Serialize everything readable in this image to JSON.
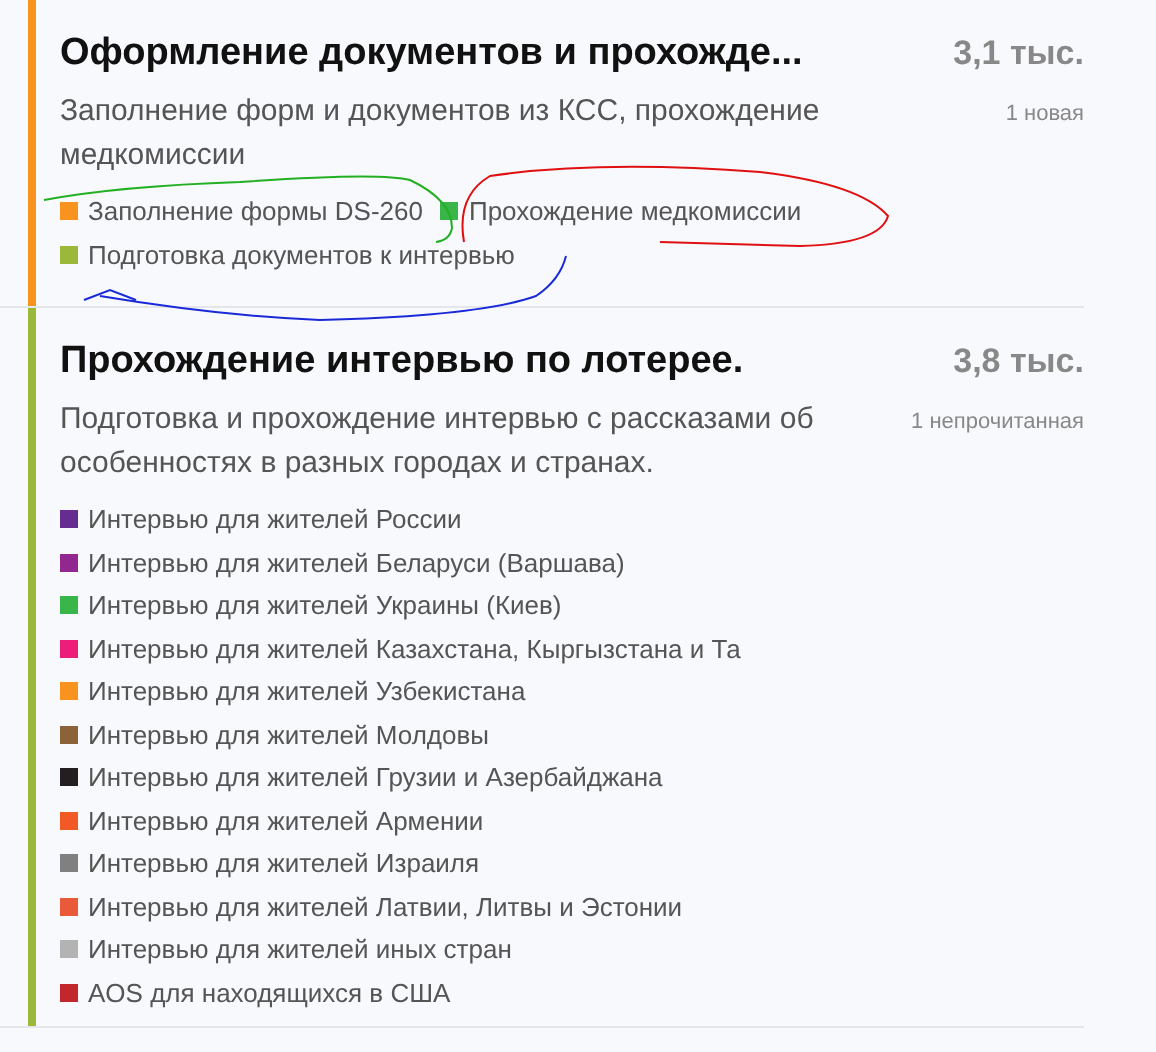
{
  "topics": [
    {
      "color": "#f7931e",
      "title": "Оформление документов и прохожде...",
      "description": "Заполнение форм и документов из КСС, прохождение медкомиссии",
      "count": "3,1 тыс.",
      "badge": "1 новая",
      "subforums": [
        {
          "name": "Заполнение формы DS-260",
          "color": "#f7931e"
        },
        {
          "name": "Прохождение медкомиссии",
          "color": "#39b54a"
        },
        {
          "name": "Подготовка документов к интервью",
          "color": "#9cb83a"
        }
      ]
    },
    {
      "color": "#9cb83a",
      "title": "Прохождение интервью по лотерее.",
      "description": "Подготовка и прохождение интервью с рассказами об особенностях в разных городах и странах.",
      "count": "3,8 тыс.",
      "badge": "1 непрочитанная",
      "subforums": [
        {
          "name": "Интервью для жителей России",
          "color": "#662d91"
        },
        {
          "name": "Интервью для жителей Беларуси (Варшава)",
          "color": "#92278f"
        },
        {
          "name": "Интервью для жителей Украины (Киев)",
          "color": "#39b54a"
        },
        {
          "name": "Интервью для жителей Казахстана, Кыргызстана и Та",
          "color": "#ed1e79"
        },
        {
          "name": "Интервью для жителей Узбекистана",
          "color": "#f7931e"
        },
        {
          "name": "Интервью для жителей Молдовы",
          "color": "#8c6239"
        },
        {
          "name": "Интервью для жителей Грузии и Азербайджана",
          "color": "#231f20"
        },
        {
          "name": "Интервью для жителей Армении",
          "color": "#f15a24"
        },
        {
          "name": "Интервью для жителей Израиля",
          "color": "#808080"
        },
        {
          "name": "Интервью для жителей Латвии, Литвы и Эстонии",
          "color": "#e95a3a"
        },
        {
          "name": "Интервью для жителей иных стран",
          "color": "#b3b3b3"
        },
        {
          "name": "AOS для находящихся в США",
          "color": "#c1272d"
        }
      ]
    }
  ]
}
